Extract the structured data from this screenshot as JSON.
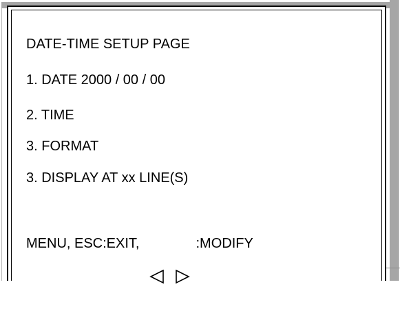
{
  "screen": {
    "title": "DATE-TIME SETUP PAGE",
    "items": [
      {
        "label": "1. DATE 2000 / 00 / 00"
      },
      {
        "label": "2. TIME"
      },
      {
        "label": "3. FORMAT"
      },
      {
        "label": "3. DISPLAY AT xx LINE(S)"
      }
    ],
    "footer": {
      "prefix": "MENU, ESC:EXIT,",
      "left_icon": "left-triangle-outline-icon",
      "right_icon": "right-triangle-outline-icon",
      "suffix": ":MODIFY"
    }
  },
  "colors": {
    "background": "#ffffff",
    "text": "#000000",
    "bevel_shadow": "#a6a6a6"
  }
}
